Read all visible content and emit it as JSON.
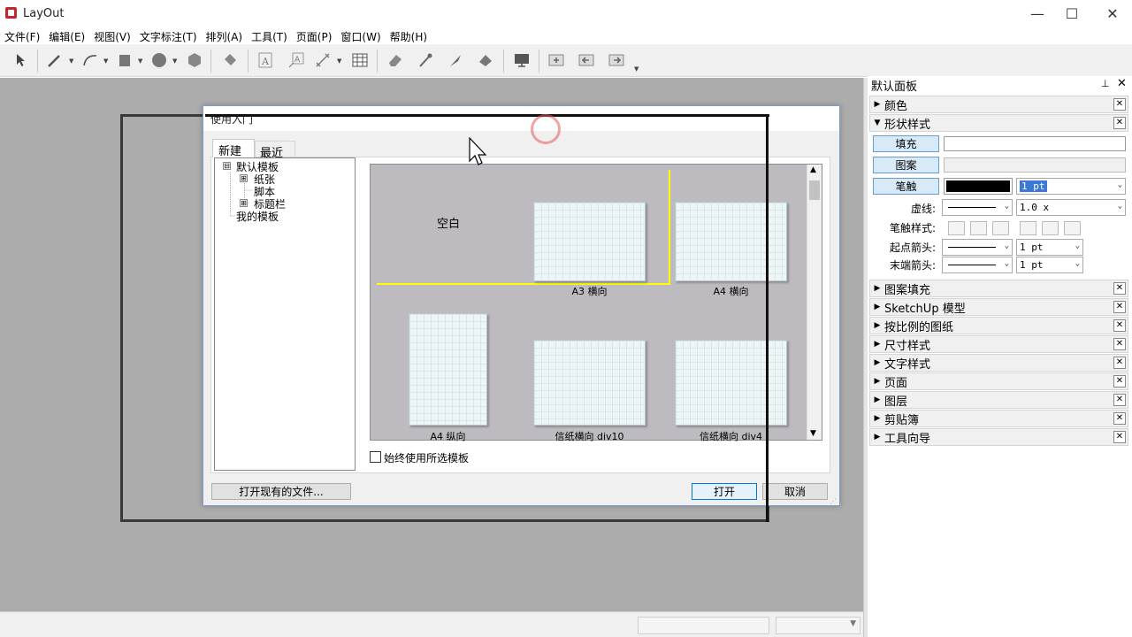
{
  "app": {
    "title": "LayOut"
  },
  "window": {
    "minimize": "—",
    "maximize": "☐",
    "close": "✕"
  },
  "menubar": [
    "文件(F)",
    "编辑(E)",
    "视图(V)",
    "文字标注(T)",
    "排列(A)",
    "工具(T)",
    "页面(P)",
    "窗口(W)",
    "帮助(H)"
  ],
  "toolbar": {
    "items": [
      "select-arrow-icon",
      "pencil-icon",
      "arc-icon",
      "rectangle-icon",
      "circle-icon",
      "polygon-icon",
      "paint-bucket-icon",
      "text-icon",
      "label-icon",
      "dimension-icon",
      "table-icon",
      "eraser-icon",
      "style-sampler-icon",
      "split-icon",
      "join-icon",
      "presentation-icon",
      "add-page-icon",
      "previous-page-icon",
      "next-page-icon"
    ]
  },
  "dialog": {
    "title": "使用入门",
    "tabs": {
      "new": "新建",
      "recent": "最近"
    },
    "tree": {
      "default_templates": "默认模板",
      "paper": "纸张",
      "script": "脚本",
      "title_bars": "标题栏",
      "my_templates": "我的模板",
      "expand_glyph": "⊞",
      "collapse_glyph": "⊟"
    },
    "templates": [
      {
        "label": "空白"
      },
      {
        "label": "A3 横向"
      },
      {
        "label": "A4 横向"
      },
      {
        "label": "A4 纵向"
      },
      {
        "label": "信纸横向 div10"
      },
      {
        "label": "信纸横向 div4"
      }
    ],
    "always_use_label": "始终使用所选模板",
    "open_existing_label": "打开现有的文件...",
    "open_label": "打开",
    "cancel_label": "取消"
  },
  "tray": {
    "title": "默认面板",
    "pin_glyph": "⊥",
    "close_glyph": "✕",
    "panels": [
      {
        "label": "颜色",
        "expanded": false
      },
      {
        "label": "形状样式",
        "expanded": true
      },
      {
        "label": "图案填充",
        "expanded": false
      },
      {
        "label": "SketchUp 模型",
        "expanded": false
      },
      {
        "label": "按比例的图纸",
        "expanded": false
      },
      {
        "label": "尺寸样式",
        "expanded": false
      },
      {
        "label": "文字样式",
        "expanded": false
      },
      {
        "label": "页面",
        "expanded": false
      },
      {
        "label": "图层",
        "expanded": false
      },
      {
        "label": "剪贴簿",
        "expanded": false
      },
      {
        "label": "工具向导",
        "expanded": false
      }
    ],
    "shape_style": {
      "fill_label": "填充",
      "pattern_label": "图案",
      "stroke_label": "笔触",
      "stroke_color": "#000000",
      "stroke_width": "1 pt",
      "dash_label": "虚线:",
      "dash_scale": "1.0 x",
      "stroke_style_label": "笔触样式:",
      "start_arrow_label": "起点箭头:",
      "start_arrow_size": "1 pt",
      "end_arrow_label": "末端箭头:",
      "end_arrow_size": "1 pt"
    }
  },
  "colors": {
    "canvas": "#acacac",
    "accent": "#d8e9f8",
    "guide": "#ffff00"
  }
}
